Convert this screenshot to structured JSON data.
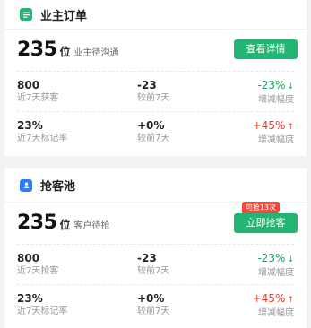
{
  "colors": {
    "accent": "#22b573",
    "up": "#ec3b2f",
    "down": "#1aa260",
    "blue_icon": "#2f7df6"
  },
  "owner_orders": {
    "title": "业主订单",
    "icon": "list-icon",
    "count": "235",
    "unit": "位",
    "desc": "业主待沟通",
    "button": "查看详情",
    "row1": {
      "v1": "800",
      "l1": "近7天获客",
      "v2": "-23",
      "l2": "较前7天",
      "v3": "-23%",
      "l3": "增减幅度"
    },
    "row2": {
      "v1": "23%",
      "l1": "近7天标记率",
      "v2": "+0%",
      "l2": "较前7天",
      "v3": "+45%",
      "l3": "增减幅度"
    }
  },
  "grab_pool": {
    "title": "抢客池",
    "icon": "contact-card-icon",
    "count": "235",
    "unit": "位",
    "desc": "客户待抢",
    "badge": "可抢13次",
    "button": "立即抢客",
    "row1": {
      "v1": "800",
      "l1": "近7天抢客",
      "v2": "-23",
      "l2": "较前7天",
      "v3": "-23%",
      "l3": "增减幅度"
    },
    "row2": {
      "v1": "23%",
      "l1": "近7天标记率",
      "v2": "+0%",
      "l2": "较前7天",
      "v3": "+45%",
      "l3": "增减幅度"
    }
  }
}
